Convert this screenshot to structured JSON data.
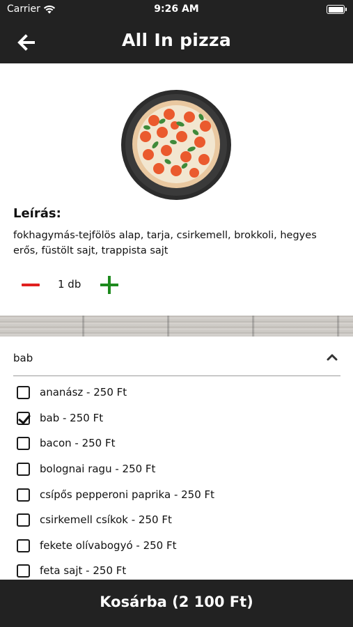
{
  "status_bar": {
    "carrier": "Carrier",
    "time": "9:26 AM",
    "icons": [
      "wifi-icon",
      "battery-icon"
    ]
  },
  "nav": {
    "title": "All In pizza",
    "back_icon": "arrow-left-icon"
  },
  "product": {
    "image": "pizza-image",
    "description_heading": "Leírás:",
    "description": "fokhagymás-tejfölös alap, tarja, csirkemell, brokkoli, hegyes erős, füstölt sajt, trappista sajt",
    "quantity": "1 db",
    "minus_icon": "minus-icon",
    "plus_icon": "plus-icon",
    "minus_color": "#e0201f",
    "plus_color": "#1e8a1e"
  },
  "topping_select": {
    "selected": "bab",
    "chevron_icon": "chevron-up-icon"
  },
  "options": [
    {
      "label": "ananász - 250 Ft",
      "checked": false
    },
    {
      "label": "bab - 250 Ft",
      "checked": true
    },
    {
      "label": "bacon - 250 Ft",
      "checked": false
    },
    {
      "label": "bolognai ragu - 250 Ft",
      "checked": false
    },
    {
      "label": "csípős pepperoni paprika - 250 Ft",
      "checked": false
    },
    {
      "label": "csirkemell csíkok - 250 Ft",
      "checked": false
    },
    {
      "label": "fekete olívabogyó - 250 Ft",
      "checked": false
    },
    {
      "label": "feta sajt - 250 Ft",
      "checked": false
    }
  ],
  "cart_button": {
    "label": "Kosárba (2 100 Ft)"
  },
  "colors": {
    "bar_background": "#222222",
    "text": "#111111"
  }
}
